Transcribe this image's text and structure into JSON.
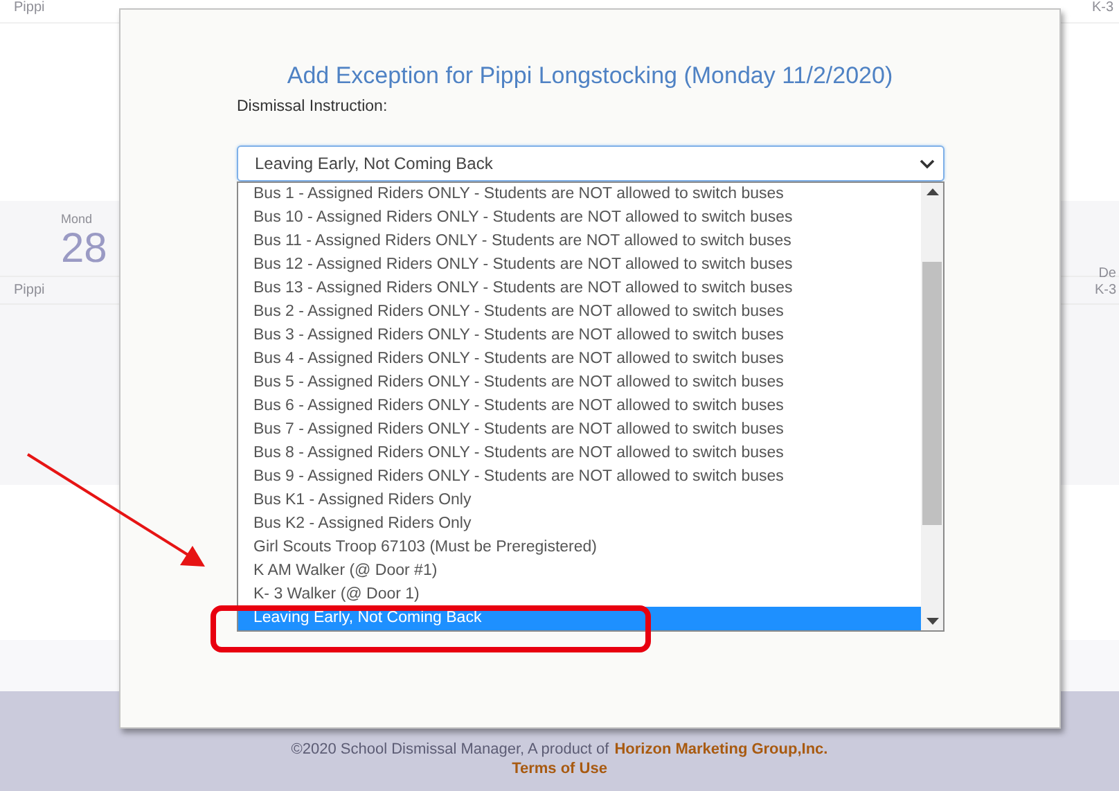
{
  "background": {
    "top_left": "Pippi",
    "top_right": "K-3",
    "day": "Mond",
    "date": "28",
    "row_name": "Pippi",
    "col_head": "De",
    "row_grade": "K-3"
  },
  "modal": {
    "title": "Add Exception for Pippi Longstocking (Monday 11/2/2020)",
    "label": "Dismissal Instruction:",
    "select_value": "Leaving Early, Not Coming Back",
    "options": [
      {
        "label": "Bus 1 - Assigned Riders ONLY - Students are NOT allowed to switch buses",
        "selected": false
      },
      {
        "label": "Bus 10 - Assigned Riders ONLY - Students are NOT allowed to switch buses",
        "selected": false
      },
      {
        "label": "Bus 11 - Assigned Riders ONLY - Students are NOT allowed to switch buses",
        "selected": false
      },
      {
        "label": "Bus 12 - Assigned Riders ONLY - Students are NOT allowed to switch buses",
        "selected": false
      },
      {
        "label": "Bus 13 - Assigned Riders ONLY - Students are NOT allowed to switch buses",
        "selected": false
      },
      {
        "label": "Bus 2 - Assigned Riders ONLY - Students are NOT allowed to switch buses",
        "selected": false
      },
      {
        "label": "Bus 3 - Assigned Riders ONLY - Students are NOT allowed to switch buses",
        "selected": false
      },
      {
        "label": "Bus 4 - Assigned Riders ONLY - Students are NOT allowed to switch buses",
        "selected": false
      },
      {
        "label": "Bus 5 - Assigned Riders ONLY - Students are NOT allowed to switch buses",
        "selected": false
      },
      {
        "label": "Bus 6 - Assigned Riders ONLY - Students are NOT allowed to switch buses",
        "selected": false
      },
      {
        "label": "Bus 7 - Assigned Riders ONLY - Students are NOT allowed to switch buses",
        "selected": false
      },
      {
        "label": "Bus 8 - Assigned Riders ONLY - Students are NOT allowed to switch buses",
        "selected": false
      },
      {
        "label": "Bus 9 - Assigned Riders ONLY - Students are NOT allowed to switch buses",
        "selected": false
      },
      {
        "label": "Bus K1 - Assigned Riders Only",
        "selected": false
      },
      {
        "label": "Bus K2 - Assigned Riders Only",
        "selected": false
      },
      {
        "label": "Girl Scouts Troop 67103 (Must be Preregistered)",
        "selected": false
      },
      {
        "label": "K AM Walker (@ Door #1)",
        "selected": false
      },
      {
        "label": "K- 3 Walker (@ Door 1)",
        "selected": false
      },
      {
        "label": "Leaving Early, Not Coming Back",
        "selected": true
      }
    ]
  },
  "footer": {
    "copyright": "©2020 School Dismissal Manager, A product of",
    "company": "Horizon Marketing Group,Inc.",
    "terms": "Terms of Use"
  }
}
